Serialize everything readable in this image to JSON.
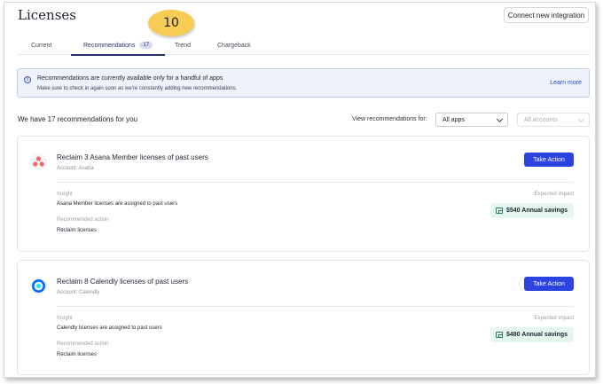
{
  "header": {
    "title": "Licenses",
    "connect_button": "Connect new integration"
  },
  "tabs": [
    {
      "label": "Current"
    },
    {
      "label": "Recommendations",
      "badge": "17"
    },
    {
      "label": "Trend"
    },
    {
      "label": "Chargeback"
    }
  ],
  "step_marker": "10",
  "banner": {
    "info_icon": "i",
    "title": "Recommendations are currently available only for a handful of apps",
    "subtitle": "Make sure to check in again soon as we're constantly adding new recommendations.",
    "link": "Learn more"
  },
  "recommendations_count_text": "We have 17 recommendations for you",
  "filters": {
    "label": "View recommendations for:",
    "apps_select": "All apps",
    "accounts_select": "All accounts"
  },
  "cards": [
    {
      "logo_icon": "asana-logo-icon",
      "title": "Reclaim 3 Asana Member licenses of past users",
      "account": "Account: Asana",
      "action_button": "Take Action",
      "insight_label": "Insight",
      "insight": "Asana Member licenses are assigned to past users",
      "recommended_label": "Recommended action",
      "recommended_action": "Reclaim licenses",
      "impact_label": "Expected impact",
      "savings": "$540 Annual savings"
    },
    {
      "logo_icon": "calendly-logo-icon",
      "title": "Reclaim 8 Calendly licenses of past users",
      "account": "Account: Calendly",
      "action_button": "Take Action",
      "insight_label": "Insight",
      "insight": "Calendly licenses are assigned to past users",
      "recommended_label": "Recommended action",
      "recommended_action": "Reclaim licenses",
      "impact_label": "Expected impact",
      "savings": "$480 Annual savings"
    }
  ],
  "colors": {
    "primary_button": "#2d43e0",
    "accent": "#2b3270",
    "banner_bg": "#edf2fc",
    "savings_bg": "#e5f7ef",
    "asana": "#f06a6a",
    "calendly": "#006bff"
  }
}
